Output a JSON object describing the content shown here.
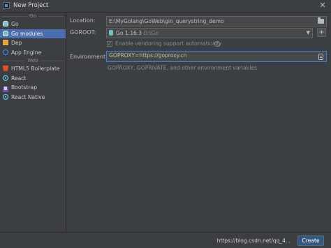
{
  "window": {
    "title": "New Project"
  },
  "sidebar": {
    "groups": [
      {
        "header": "Go",
        "items": [
          {
            "label": "Go",
            "icon": "gopher-icon"
          },
          {
            "label": "Go modules",
            "icon": "gopher-icon",
            "selected": true
          },
          {
            "label": "Dep",
            "icon": "dep-icon"
          },
          {
            "label": "App Engine",
            "icon": "app-engine-icon"
          }
        ]
      },
      {
        "header": "Web",
        "items": [
          {
            "label": "HTML5 Boilerplate",
            "icon": "html5-icon"
          },
          {
            "label": "React",
            "icon": "react-icon"
          },
          {
            "label": "Bootstrap",
            "icon": "bootstrap-icon"
          },
          {
            "label": "React Native",
            "icon": "react-icon"
          }
        ]
      }
    ]
  },
  "form": {
    "location": {
      "label": "Location:",
      "value": "E:\\MyGolang\\GoWeb\\gin_querystring_demo"
    },
    "goroot": {
      "label": "GOROOT:",
      "sdk": "Go 1.16.3",
      "path": "D:\\Go"
    },
    "vendoring": {
      "label": "Enable vendoring support automatically",
      "checked": true
    },
    "environment": {
      "label": "Environment:",
      "value": "GOPROXY=https://goproxy.cn",
      "hint": "GOPROXY, GOPRIVATE, and other environment variables"
    }
  },
  "footer": {
    "create_label": "Create",
    "watermark": "https://blog.csdn.net/qq_4..."
  },
  "colors": {
    "background": "#3c3f41",
    "selection": "#4b6eaf",
    "focus_border": "#3d7ed8",
    "primary_button": "#365880"
  }
}
